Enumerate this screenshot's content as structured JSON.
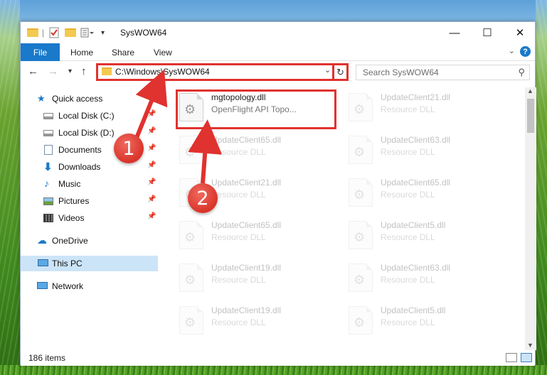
{
  "window": {
    "title": "SysWOW64",
    "controls": {
      "minimize": "—",
      "maximize": "☐",
      "close": "✕"
    }
  },
  "ribbon": {
    "file_tab": "File",
    "tabs": [
      "Home",
      "Share",
      "View"
    ]
  },
  "address": {
    "path": "C:\\Windows\\SysWOW64",
    "search_placeholder": "Search SysWOW64"
  },
  "nav": {
    "items": [
      {
        "label": "Quick access",
        "icon": "star-icon"
      },
      {
        "label": "Local Disk (C:)",
        "icon": "drive-icon",
        "pinned": true
      },
      {
        "label": "Local Disk (D:)",
        "icon": "drive-icon",
        "pinned": true
      },
      {
        "label": "Documents",
        "icon": "documents-icon",
        "pinned": true
      },
      {
        "label": "Downloads",
        "icon": "download-icon",
        "pinned": true
      },
      {
        "label": "Music",
        "icon": "music-icon",
        "pinned": true
      },
      {
        "label": "Pictures",
        "icon": "pictures-icon",
        "pinned": true
      },
      {
        "label": "Videos",
        "icon": "videos-icon",
        "pinned": true
      },
      {
        "label": "OneDrive",
        "icon": "cloud-icon"
      },
      {
        "label": "This PC",
        "icon": "computer-icon",
        "selected": true
      },
      {
        "label": "Network",
        "icon": "network-icon"
      }
    ]
  },
  "files": [
    {
      "name": "mgtopology.dll",
      "desc": "OpenFlight API Topo..."
    },
    {
      "name": "UpdateClient21.dll",
      "desc": "Resource DLL"
    },
    {
      "name": "UpdateClient65.dll",
      "desc": "Resource DLL"
    },
    {
      "name": "UpdateClient63.dll",
      "desc": "Resource DLL"
    },
    {
      "name": "UpdateClient21.dll",
      "desc": "Resource DLL"
    },
    {
      "name": "UpdateClient65.dll",
      "desc": "Resource DLL"
    },
    {
      "name": "UpdateClient65.dll",
      "desc": "Resource DLL"
    },
    {
      "name": "UpdateClient5.dll",
      "desc": "Resource DLL"
    },
    {
      "name": "UpdateClient19.dll",
      "desc": "Resource DLL"
    },
    {
      "name": "UpdateClient63.dll",
      "desc": "Resource DLL"
    },
    {
      "name": "UpdateClient19.dll",
      "desc": "Resource DLL"
    },
    {
      "name": "UpdateClient5.dll",
      "desc": "Resource DLL"
    }
  ],
  "status": {
    "item_count": "186 items"
  },
  "annotations": {
    "step1": "1",
    "step2": "2",
    "color": "#e0322e"
  }
}
